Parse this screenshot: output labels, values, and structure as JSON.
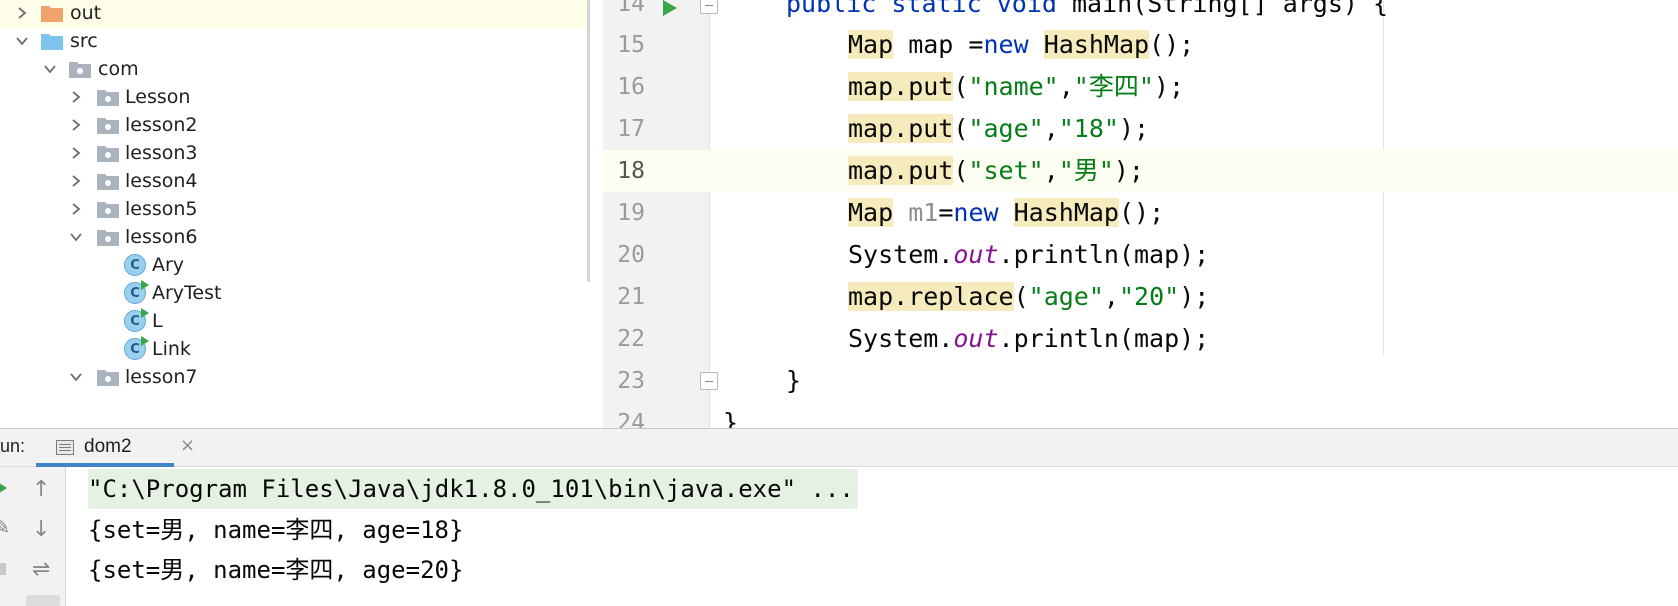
{
  "project_tree": {
    "items": [
      {
        "label": "out",
        "kind": "folder-orange",
        "state": "collapsed",
        "selected": true
      },
      {
        "label": "src",
        "kind": "folder-blue",
        "state": "expanded"
      },
      {
        "label": "com",
        "kind": "package",
        "state": "expanded"
      },
      {
        "label": "Lesson",
        "kind": "package",
        "state": "collapsed"
      },
      {
        "label": "lesson2",
        "kind": "package",
        "state": "collapsed"
      },
      {
        "label": "lesson3",
        "kind": "package",
        "state": "collapsed"
      },
      {
        "label": "lesson4",
        "kind": "package",
        "state": "collapsed"
      },
      {
        "label": "lesson5",
        "kind": "package",
        "state": "collapsed"
      },
      {
        "label": "lesson6",
        "kind": "package",
        "state": "expanded"
      },
      {
        "label": "Ary",
        "kind": "class"
      },
      {
        "label": "AryTest",
        "kind": "class-runnable"
      },
      {
        "label": "L",
        "kind": "class-runnable"
      },
      {
        "label": "Link",
        "kind": "class-runnable"
      },
      {
        "label": "lesson7",
        "kind": "package",
        "state": "expanded"
      }
    ]
  },
  "editor": {
    "line_numbers": [
      "14",
      "15",
      "16",
      "17",
      "18",
      "19",
      "20",
      "21",
      "22",
      "23",
      "24"
    ],
    "current_line": "18",
    "tokens": {
      "l14_kw": "public static void ",
      "l14_rest": "main(String[] args) {",
      "map_type": "Map",
      "map_var": " map =",
      "new_kw": "new",
      "hashmap": "HashMap",
      "ctor_end": "();",
      "map_put": "map.put",
      "open_paren": "(",
      "str_name": "\"name\"",
      "comma": ",",
      "str_lisi": "\"李四\"",
      "close_stmt": ");",
      "str_age": "\"age\"",
      "str_18": "\"18\"",
      "str_set": "\"set\"",
      "str_nan": "\"男\"",
      "m1_var": "m1",
      "eq": "=",
      "system": "System.",
      "out": "out",
      "println_map": ".println(map);",
      "map_replace": "map.replace",
      "str_20": "\"20\"",
      "close_brace": "}"
    }
  },
  "run_panel": {
    "label": "un:",
    "tab_label": "dom2",
    "tab_close": "×",
    "console_lines": [
      "\"C:\\Program Files\\Java\\jdk1.8.0_101\\bin\\java.exe\" ...",
      "{set=男, name=李四, age=18}",
      "{set=男, name=李四, age=20}"
    ],
    "toolbar_icons": [
      "up-arrow-icon",
      "down-arrow-icon",
      "soft-wrap-icon",
      "scroll-to-end-icon"
    ]
  },
  "colors": {
    "keyword": "#0033b3",
    "string": "#067d17",
    "static_field": "#871094",
    "usage_highlight": "#f6ebbc",
    "current_line": "#fefdf1",
    "selected_row": "#fefde8",
    "folder_out": "#f0a46c",
    "folder_src": "#7fc4ec",
    "command_line_bg": "#e5f1e3"
  }
}
